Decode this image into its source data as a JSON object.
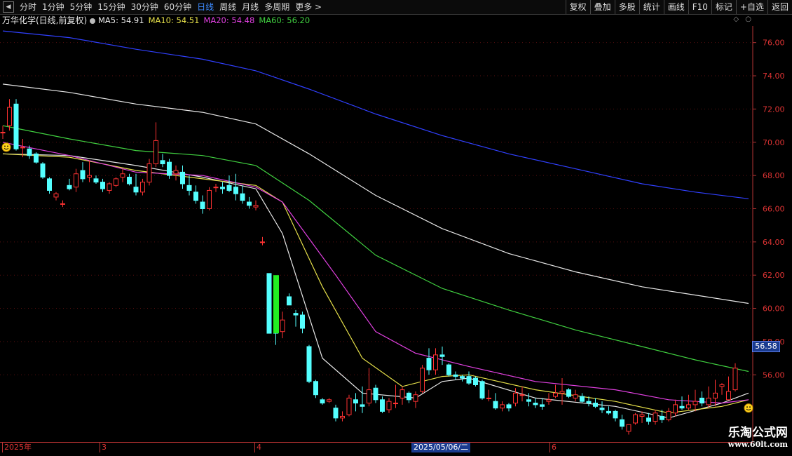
{
  "toolbar": {
    "periods": [
      {
        "label": "分时"
      },
      {
        "label": "1分钟"
      },
      {
        "label": "5分钟"
      },
      {
        "label": "15分钟"
      },
      {
        "label": "30分钟"
      },
      {
        "label": "60分钟"
      },
      {
        "label": "日线"
      },
      {
        "label": "周线"
      },
      {
        "label": "月线"
      },
      {
        "label": "多周期"
      },
      {
        "label": "更多 >"
      }
    ],
    "active_period": "日线",
    "buttons": [
      {
        "label": "复权"
      },
      {
        "label": "叠加"
      },
      {
        "label": "多股"
      },
      {
        "label": "统计"
      },
      {
        "label": "画线"
      },
      {
        "label": "F10"
      },
      {
        "label": "标记"
      },
      {
        "label": "+自选"
      },
      {
        "label": "返回"
      }
    ]
  },
  "header": {
    "stock_title": "万华化学(日线,前复权)",
    "ma": [
      {
        "label": "MA5: 54.91",
        "color": "#e8e8e8"
      },
      {
        "label": "MA10: 54.51",
        "color": "#e6e04a"
      },
      {
        "label": "MA20: 54.48",
        "color": "#e040e0"
      },
      {
        "label": "MA60: 56.20",
        "color": "#40d040"
      }
    ]
  },
  "current_price_tag": "56.58",
  "colors": {
    "up": "#ff3232",
    "down": "#54ffff",
    "ma5": "#e8e8e8",
    "ma10": "#e6e04a",
    "ma20": "#e040e0",
    "ma60": "#40d040",
    "ma120": "#e8e8e8",
    "ma250": "#3040ff",
    "axis": "#b33333"
  },
  "date_axis": {
    "labels": [
      {
        "text": "2025年"
      },
      {
        "text": "3"
      },
      {
        "text": "4"
      },
      {
        "text": "6"
      }
    ],
    "cursor_date": "2025/05/06/二"
  },
  "watermark": {
    "title": "乐淘公式网",
    "url": "www.60lt.com"
  },
  "chart_data": {
    "type": "candlestick",
    "y_axis_ticks": [
      56.0,
      58.0,
      60.0,
      62.0,
      64.0,
      66.0,
      68.0,
      70.0,
      72.0,
      74.0,
      76.0
    ],
    "ylim": [
      52.0,
      77.0
    ],
    "candles": [
      [
        70.6,
        71.0,
        70.2,
        70.6
      ],
      [
        71.0,
        72.6,
        70.7,
        72.1
      ],
      [
        72.3,
        72.6,
        69.5,
        69.6
      ],
      [
        69.7,
        70.2,
        69.1,
        69.7
      ],
      [
        69.6,
        69.8,
        69.0,
        69.2
      ],
      [
        69.3,
        69.4,
        68.7,
        68.8
      ],
      [
        68.7,
        68.8,
        67.8,
        67.9
      ],
      [
        67.8,
        67.9,
        66.9,
        67.1
      ],
      [
        66.7,
        67.0,
        66.5,
        66.9
      ],
      [
        66.3,
        66.5,
        66.1,
        66.3
      ],
      [
        67.4,
        67.8,
        67.1,
        67.2
      ],
      [
        67.3,
        68.4,
        67.0,
        68.1
      ],
      [
        68.3,
        68.8,
        67.6,
        67.8
      ],
      [
        67.9,
        68.9,
        67.6,
        68.0
      ],
      [
        67.8,
        68.0,
        67.5,
        67.6
      ],
      [
        67.6,
        67.8,
        67.0,
        67.2
      ],
      [
        67.1,
        67.6,
        66.9,
        67.5
      ],
      [
        67.4,
        67.9,
        67.3,
        67.8
      ],
      [
        67.9,
        68.4,
        67.6,
        68.1
      ],
      [
        67.9,
        68.1,
        67.4,
        67.5
      ],
      [
        67.3,
        68.1,
        66.8,
        67.0
      ],
      [
        67.0,
        67.8,
        66.8,
        67.6
      ],
      [
        67.6,
        69.0,
        67.4,
        68.7
      ],
      [
        68.7,
        71.2,
        68.5,
        70.1
      ],
      [
        68.9,
        69.3,
        68.5,
        68.7
      ],
      [
        68.8,
        69.0,
        67.8,
        68.0
      ],
      [
        68.1,
        68.6,
        67.7,
        68.3
      ],
      [
        68.2,
        68.6,
        67.2,
        67.5
      ],
      [
        67.4,
        68.0,
        66.8,
        67.1
      ],
      [
        67.0,
        67.4,
        66.3,
        66.5
      ],
      [
        66.4,
        66.8,
        65.7,
        66.0
      ],
      [
        66.0,
        67.3,
        65.9,
        67.1
      ],
      [
        67.3,
        67.5,
        67.0,
        67.3
      ],
      [
        67.3,
        67.6,
        66.9,
        67.2
      ],
      [
        67.4,
        68.0,
        67.0,
        67.1
      ],
      [
        67.3,
        68.1,
        66.5,
        66.9
      ],
      [
        66.9,
        67.4,
        66.3,
        66.5
      ],
      [
        66.4,
        66.7,
        66.0,
        66.2
      ],
      [
        66.1,
        66.5,
        65.9,
        66.2
      ],
      [
        64.0,
        64.3,
        63.8,
        64.0
      ],
      [
        62.1,
        62.1,
        59.4,
        58.5
      ],
      [
        59.6,
        59.8,
        57.8,
        58.5
      ],
      [
        58.6,
        59.8,
        58.2,
        59.3
      ],
      [
        60.7,
        60.9,
        60.2,
        60.2
      ],
      [
        59.7,
        59.9,
        58.9,
        59.6
      ],
      [
        59.6,
        59.8,
        58.5,
        58.8
      ],
      [
        57.7,
        57.8,
        55.5,
        55.6
      ],
      [
        55.6,
        55.7,
        54.6,
        54.8
      ],
      [
        54.5,
        54.6,
        54.2,
        54.3
      ],
      [
        54.4,
        54.6,
        54.3,
        54.5
      ],
      [
        54.0,
        54.2,
        53.2,
        53.4
      ],
      [
        53.4,
        53.8,
        53.2,
        53.5
      ],
      [
        53.6,
        54.8,
        53.5,
        54.6
      ],
      [
        54.5,
        54.9,
        53.8,
        54.3
      ],
      [
        54.2,
        55.3,
        53.7,
        54.1
      ],
      [
        54.3,
        56.4,
        54.1,
        55.1
      ],
      [
        55.2,
        55.4,
        54.3,
        54.5
      ],
      [
        54.5,
        54.7,
        53.7,
        53.8
      ],
      [
        53.9,
        54.6,
        53.7,
        54.4
      ],
      [
        54.3,
        55.4,
        54.0,
        54.3
      ],
      [
        54.6,
        55.3,
        54.2,
        55.1
      ],
      [
        54.9,
        55.0,
        54.3,
        54.5
      ],
      [
        54.4,
        55.0,
        54.0,
        54.8
      ],
      [
        55.0,
        56.6,
        54.9,
        56.4
      ],
      [
        57.0,
        57.6,
        56.0,
        56.3
      ],
      [
        56.3,
        57.6,
        56.0,
        57.2
      ],
      [
        57.2,
        57.7,
        56.6,
        57.1
      ],
      [
        56.6,
        56.7,
        55.9,
        56.0
      ],
      [
        56.0,
        56.2,
        55.7,
        55.9
      ],
      [
        55.9,
        56.0,
        55.6,
        55.8
      ],
      [
        55.9,
        56.2,
        55.4,
        55.5
      ],
      [
        55.8,
        55.9,
        55.3,
        55.4
      ],
      [
        55.6,
        55.7,
        54.5,
        54.6
      ],
      [
        54.6,
        55.1,
        54.4,
        54.6
      ],
      [
        54.4,
        54.9,
        53.9,
        54.0
      ],
      [
        54.0,
        54.4,
        53.8,
        54.2
      ],
      [
        54.2,
        54.3,
        53.8,
        54.0
      ],
      [
        54.3,
        55.2,
        54.1,
        54.9
      ],
      [
        54.8,
        55.3,
        54.4,
        54.8
      ],
      [
        54.5,
        54.9,
        54.1,
        54.4
      ],
      [
        54.3,
        54.6,
        54.0,
        54.2
      ],
      [
        54.2,
        54.6,
        53.9,
        54.1
      ],
      [
        54.4,
        54.9,
        54.2,
        54.5
      ],
      [
        54.7,
        55.4,
        54.6,
        54.9
      ],
      [
        54.9,
        55.8,
        54.2,
        55.0
      ],
      [
        55.1,
        55.2,
        54.6,
        54.7
      ],
      [
        54.6,
        55.1,
        54.4,
        54.8
      ],
      [
        54.7,
        54.9,
        54.3,
        54.4
      ],
      [
        54.4,
        54.7,
        54.1,
        54.3
      ],
      [
        54.3,
        54.6,
        54.0,
        54.1
      ],
      [
        54.0,
        54.4,
        53.7,
        53.9
      ],
      [
        53.8,
        54.1,
        53.6,
        53.7
      ],
      [
        53.8,
        53.9,
        53.2,
        53.4
      ],
      [
        53.3,
        53.6,
        52.7,
        52.9
      ],
      [
        52.6,
        53.0,
        52.4,
        53.0
      ],
      [
        53.1,
        53.7,
        53.0,
        53.6
      ],
      [
        53.5,
        53.8,
        53.1,
        53.6
      ],
      [
        53.4,
        53.7,
        53.0,
        53.2
      ],
      [
        53.2,
        53.9,
        53.0,
        53.7
      ],
      [
        53.5,
        53.9,
        53.1,
        53.3
      ],
      [
        53.3,
        54.0,
        53.2,
        53.8
      ],
      [
        53.7,
        54.5,
        53.5,
        54.2
      ],
      [
        54.1,
        54.7,
        53.9,
        54.0
      ],
      [
        54.0,
        54.8,
        53.9,
        54.2
      ],
      [
        54.2,
        55.1,
        53.8,
        54.4
      ],
      [
        54.6,
        55.0,
        54.1,
        54.3
      ],
      [
        54.2,
        55.3,
        54.0,
        54.6
      ],
      [
        54.6,
        55.7,
        54.1,
        54.9
      ],
      [
        55.3,
        55.5,
        54.8,
        55.4
      ],
      [
        54.5,
        55.9,
        54.5,
        55.0
      ],
      [
        55.1,
        56.7,
        55.0,
        56.4
      ]
    ],
    "ma_lines": [
      {
        "name": "MA5",
        "points": [
          [
            0,
            69.3
          ],
          [
            10,
            69.2
          ],
          [
            20,
            68.6
          ],
          [
            30,
            67.9
          ],
          [
            38,
            67.2
          ],
          [
            42,
            64.5
          ],
          [
            48,
            57.0
          ],
          [
            54,
            54.9
          ],
          [
            62,
            54.6
          ],
          [
            66,
            55.6
          ],
          [
            70,
            55.8
          ],
          [
            80,
            54.6
          ],
          [
            92,
            54.1
          ],
          [
            100,
            53.4
          ],
          [
            108,
            54.3
          ],
          [
            112,
            54.9
          ]
        ]
      },
      {
        "name": "MA10",
        "points": [
          [
            0,
            69.3
          ],
          [
            10,
            69.1
          ],
          [
            20,
            68.3
          ],
          [
            30,
            67.8
          ],
          [
            38,
            67.4
          ],
          [
            42,
            66.4
          ],
          [
            48,
            61.3
          ],
          [
            54,
            57.0
          ],
          [
            60,
            55.3
          ],
          [
            66,
            55.9
          ],
          [
            70,
            56.0
          ],
          [
            80,
            55.1
          ],
          [
            92,
            54.4
          ],
          [
            100,
            53.7
          ],
          [
            108,
            54.1
          ],
          [
            112,
            54.5
          ]
        ]
      },
      {
        "name": "MA20",
        "points": [
          [
            0,
            70.0
          ],
          [
            10,
            69.2
          ],
          [
            20,
            68.2
          ],
          [
            30,
            68.0
          ],
          [
            38,
            67.3
          ],
          [
            42,
            66.4
          ],
          [
            50,
            62.0
          ],
          [
            56,
            58.6
          ],
          [
            62,
            57.3
          ],
          [
            70,
            56.5
          ],
          [
            80,
            55.6
          ],
          [
            92,
            55.1
          ],
          [
            100,
            54.5
          ],
          [
            108,
            54.3
          ],
          [
            112,
            54.5
          ]
        ]
      },
      {
        "name": "MA60",
        "points": [
          [
            0,
            71.0
          ],
          [
            10,
            70.2
          ],
          [
            20,
            69.5
          ],
          [
            30,
            69.2
          ],
          [
            38,
            68.6
          ],
          [
            46,
            66.5
          ],
          [
            56,
            63.2
          ],
          [
            66,
            61.2
          ],
          [
            76,
            59.9
          ],
          [
            86,
            58.7
          ],
          [
            96,
            57.7
          ],
          [
            104,
            56.9
          ],
          [
            112,
            56.2
          ]
        ]
      },
      {
        "name": "MA120",
        "points": [
          [
            0,
            73.5
          ],
          [
            10,
            73.0
          ],
          [
            20,
            72.3
          ],
          [
            30,
            71.8
          ],
          [
            38,
            71.1
          ],
          [
            46,
            69.3
          ],
          [
            56,
            66.8
          ],
          [
            66,
            64.8
          ],
          [
            76,
            63.3
          ],
          [
            86,
            62.2
          ],
          [
            96,
            61.3
          ],
          [
            104,
            60.8
          ],
          [
            112,
            60.3
          ]
        ]
      },
      {
        "name": "MA250",
        "points": [
          [
            0,
            76.7
          ],
          [
            10,
            76.3
          ],
          [
            20,
            75.6
          ],
          [
            30,
            75.0
          ],
          [
            38,
            74.3
          ],
          [
            46,
            73.2
          ],
          [
            56,
            71.7
          ],
          [
            66,
            70.4
          ],
          [
            76,
            69.3
          ],
          [
            86,
            68.4
          ],
          [
            96,
            67.5
          ],
          [
            104,
            67.0
          ],
          [
            112,
            66.6
          ]
        ]
      }
    ]
  }
}
